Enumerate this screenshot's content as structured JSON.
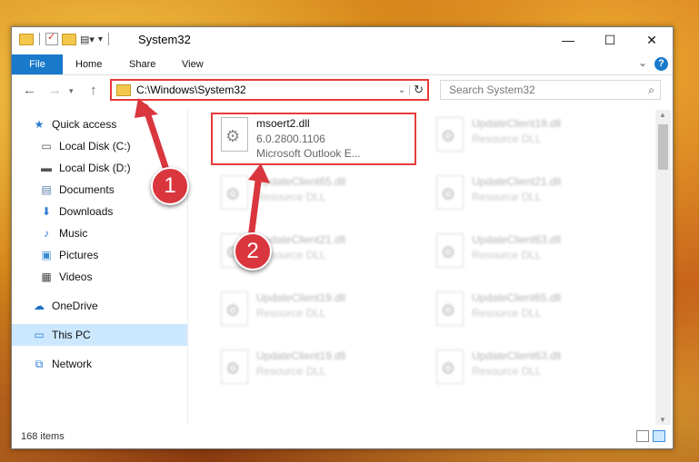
{
  "window": {
    "title": "System32"
  },
  "window_controls": {
    "minimize": "—",
    "maximize": "☐",
    "close": "✕"
  },
  "ribbon": {
    "tabs": [
      "File",
      "Home",
      "Share",
      "View"
    ],
    "help": "?"
  },
  "nav": {
    "address": "C:\\Windows\\System32",
    "search_placeholder": "Search System32"
  },
  "sidebar": {
    "items": [
      {
        "label": "Quick access",
        "icon": "star-icon",
        "pinned": false
      },
      {
        "label": "Local Disk (C:)",
        "icon": "drive-icon",
        "pinned": true
      },
      {
        "label": "Local Disk (D:)",
        "icon": "drive-icon",
        "pinned": true
      },
      {
        "label": "Documents",
        "icon": "documents-icon",
        "pinned": true
      },
      {
        "label": "Downloads",
        "icon": "download-icon",
        "pinned": true
      },
      {
        "label": "Music",
        "icon": "music-icon",
        "pinned": true
      },
      {
        "label": "Pictures",
        "icon": "pictures-icon",
        "pinned": true
      },
      {
        "label": "Videos",
        "icon": "videos-icon",
        "pinned": true
      },
      {
        "label": "OneDrive",
        "icon": "cloud-icon",
        "pinned": false
      },
      {
        "label": "This PC",
        "icon": "computer-icon",
        "pinned": false,
        "selected": true
      },
      {
        "label": "Network",
        "icon": "network-icon",
        "pinned": false
      }
    ]
  },
  "files": [
    {
      "name": "msoert2.dll",
      "version": "6.0.2800.1106",
      "desc": "Microsoft Outlook E...",
      "highlighted": true
    },
    {
      "name": "UpdateClient19.dll",
      "desc": "Resource DLL"
    },
    {
      "name": "UpdateClient65.dll",
      "desc": "Resource DLL"
    },
    {
      "name": "UpdateClient21.dll",
      "desc": "Resource DLL"
    },
    {
      "name": "UpdateClient21.dll",
      "desc": "Resource DLL"
    },
    {
      "name": "UpdateClient63.dll",
      "desc": "Resource DLL"
    },
    {
      "name": "UpdateClient19.dll",
      "desc": "Resource DLL"
    },
    {
      "name": "UpdateClient65.dll",
      "desc": "Resource DLL"
    },
    {
      "name": "UpdateClient19.dll",
      "desc": "Resource DLL"
    },
    {
      "name": "UpdateClient63.dll",
      "desc": "Resource DLL"
    }
  ],
  "status": {
    "count": "168 items"
  },
  "annotations": {
    "badge1": "1",
    "badge2": "2",
    "color": "#d9363e"
  }
}
